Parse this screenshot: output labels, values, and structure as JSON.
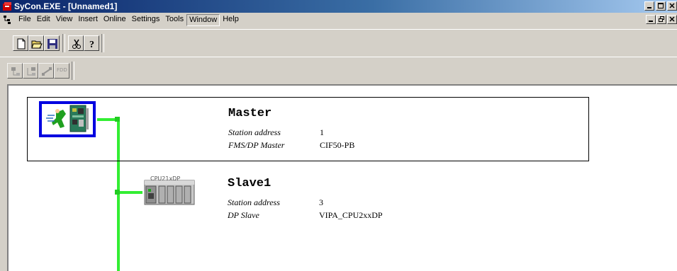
{
  "window": {
    "title": "SyCon.EXE - [Unnamed1]"
  },
  "menu": [
    {
      "label": "File",
      "active": false
    },
    {
      "label": "Edit",
      "active": false
    },
    {
      "label": "View",
      "active": false
    },
    {
      "label": "Insert",
      "active": false
    },
    {
      "label": "Online",
      "active": false
    },
    {
      "label": "Settings",
      "active": false
    },
    {
      "label": "Tools",
      "active": false
    },
    {
      "label": "Window",
      "active": true
    },
    {
      "label": "Help",
      "active": false
    }
  ],
  "toolbar": {
    "buttons": [
      "new-icon",
      "open-icon",
      "save-icon",
      "cut-icon",
      "help-icon"
    ],
    "second_row": [
      "insert-master-icon",
      "insert-slave-icon",
      "connect-icon",
      "fdd-icon"
    ],
    "fdd_label": "FDD"
  },
  "master": {
    "title": "Master",
    "station_address_label": "Station address",
    "station_address_value": "1",
    "type_label": "FMS/DP Master",
    "type_value": "CIF50-PB"
  },
  "slave": {
    "title": "Slave1",
    "icon_label": "CPU21xDP",
    "station_address_label": "Station address",
    "station_address_value": "3",
    "type_label": "DP Slave",
    "type_value": "VIPA_CPU2xxDP"
  },
  "colors": {
    "bus": "#33ee33",
    "selection": "#0000e0"
  }
}
